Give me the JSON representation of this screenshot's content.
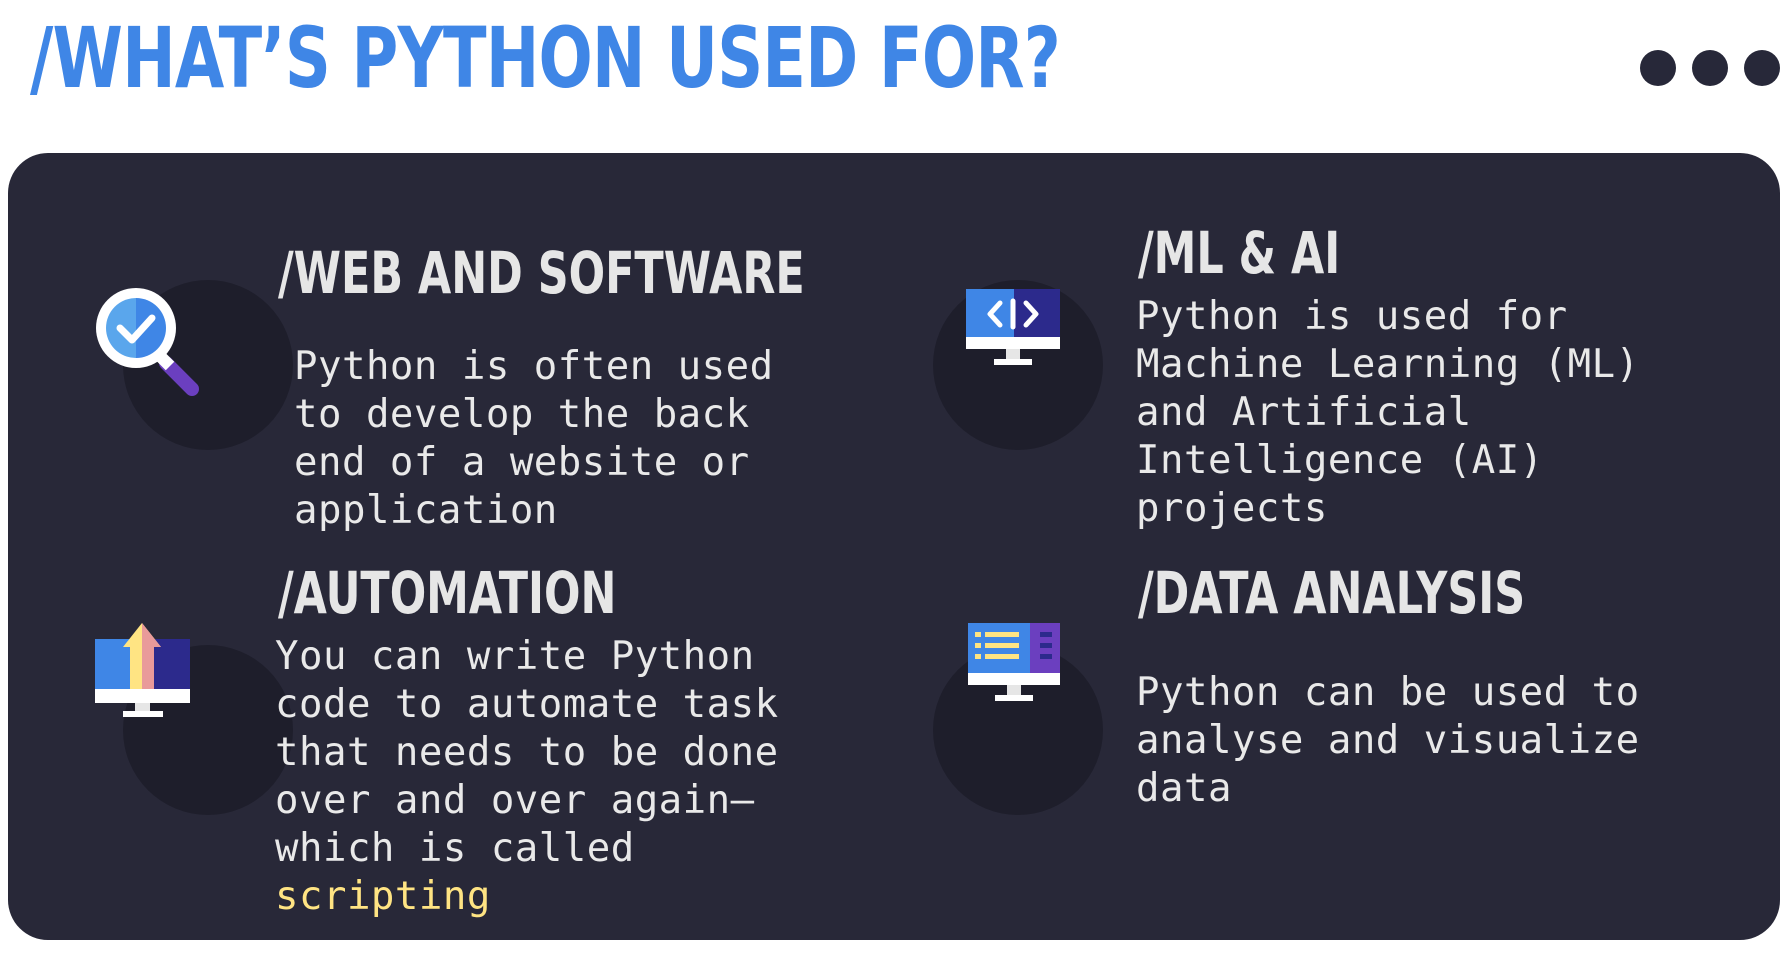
{
  "page": {
    "title": "/WHAT’S PYTHON USED FOR?"
  },
  "header_icons": [
    "dot-icon",
    "dot-icon",
    "dot-icon"
  ],
  "cards": [
    {
      "title": "/WEB AND SOFTWARE",
      "text": "Python is often used to develop the back end of a website or application",
      "icon": "magnifier-check-icon"
    },
    {
      "title": "/ML & AI",
      "text": "Python is used for Machine Learning (ML) and Artificial Intelligence (AI) projects",
      "icon": "monitor-code-icon"
    },
    {
      "title": "/AUTOMATION",
      "text": "You can write Python code to automate task that needs to be done over and over again—which is called",
      "highlight": "scripting",
      "icon": "monitor-upload-icon"
    },
    {
      "title": "/DATA ANALYSIS",
      "text": "Python can be used to analyse and visualize data",
      "icon": "monitor-data-icon"
    }
  ],
  "colors": {
    "title": "#3f86e6",
    "panel": "#282838",
    "highlight": "#ffe483",
    "dot": "#272839"
  }
}
